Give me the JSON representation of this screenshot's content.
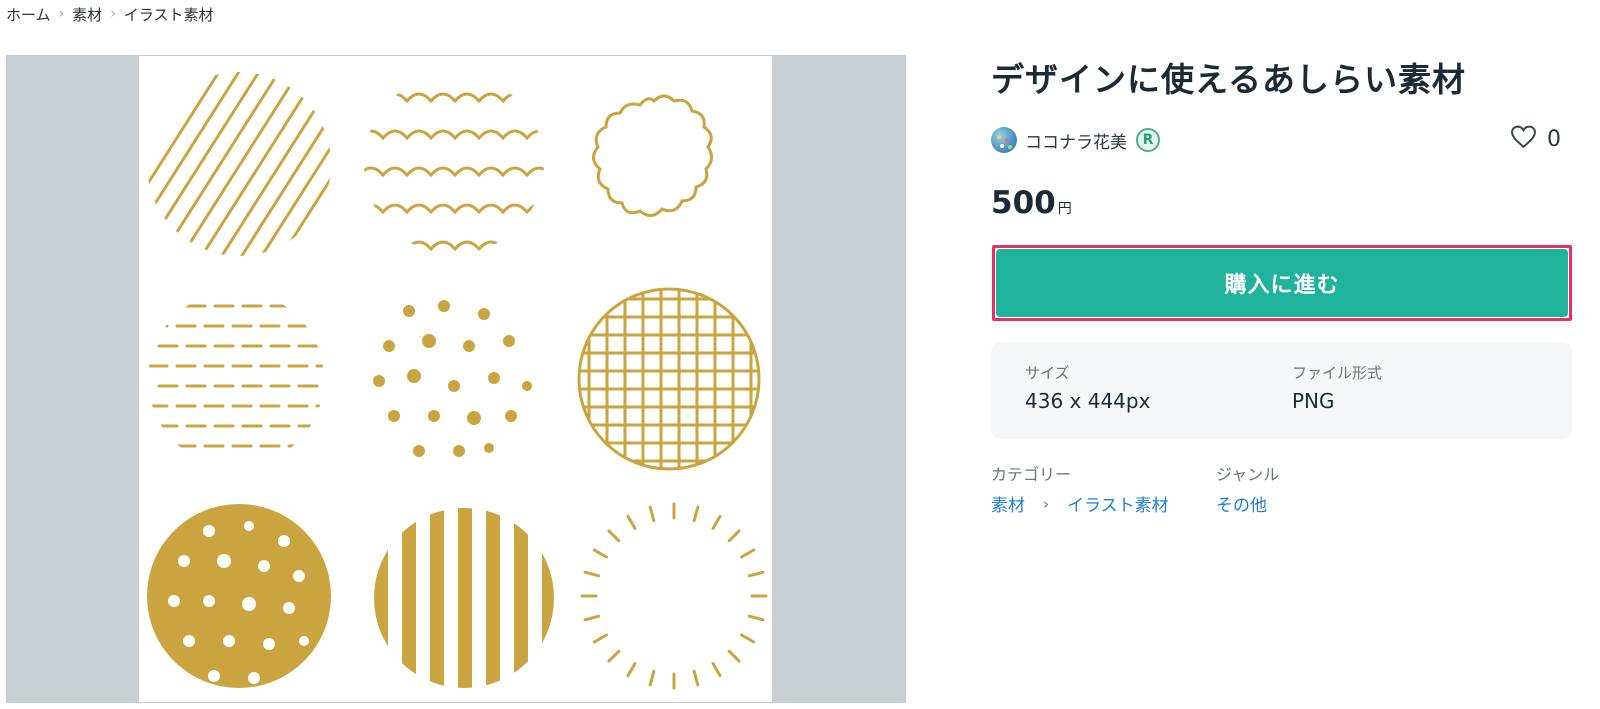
{
  "breadcrumb": {
    "items": [
      "ホーム",
      "素材",
      "イラスト素材"
    ]
  },
  "product": {
    "title": "デザインに使えるあしらい素材",
    "seller": {
      "name": "ココナラ花美",
      "rank_badge": "R"
    },
    "favorite": {
      "icon": "heart-outline-icon",
      "count": "0"
    },
    "price": {
      "value": "500",
      "unit": "円"
    },
    "buy_button_label": "購入に進む",
    "specs": [
      {
        "label": "サイズ",
        "value": "436 x 444px"
      },
      {
        "label": "ファイル形式",
        "value": "PNG"
      }
    ],
    "category": {
      "label": "カテゴリー",
      "path": [
        "素材",
        "イラスト素材"
      ]
    },
    "genre": {
      "label": "ジャンル",
      "value": "その他"
    }
  },
  "colors": {
    "accent_button": "#1fb39c",
    "highlight_outline": "#ea2d6b",
    "link": "#1e7fd8",
    "illustration_gold": "#c9a43f"
  }
}
